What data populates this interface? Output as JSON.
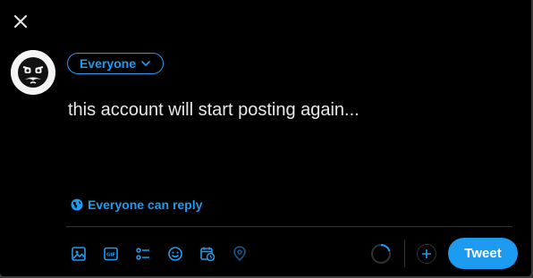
{
  "composer": {
    "audience_label": "Everyone",
    "text": "this account will start posting again...",
    "reply_setting": "Everyone can reply",
    "tweet_button": "Tweet"
  },
  "toolbar": {
    "icons": [
      "media-icon",
      "gif-icon",
      "poll-icon",
      "emoji-icon",
      "schedule-icon",
      "location-icon"
    ]
  },
  "colors": {
    "background": "#000000",
    "accent": "#1d9bf0",
    "text": "#e7e9ea",
    "divider": "#2f3336"
  }
}
